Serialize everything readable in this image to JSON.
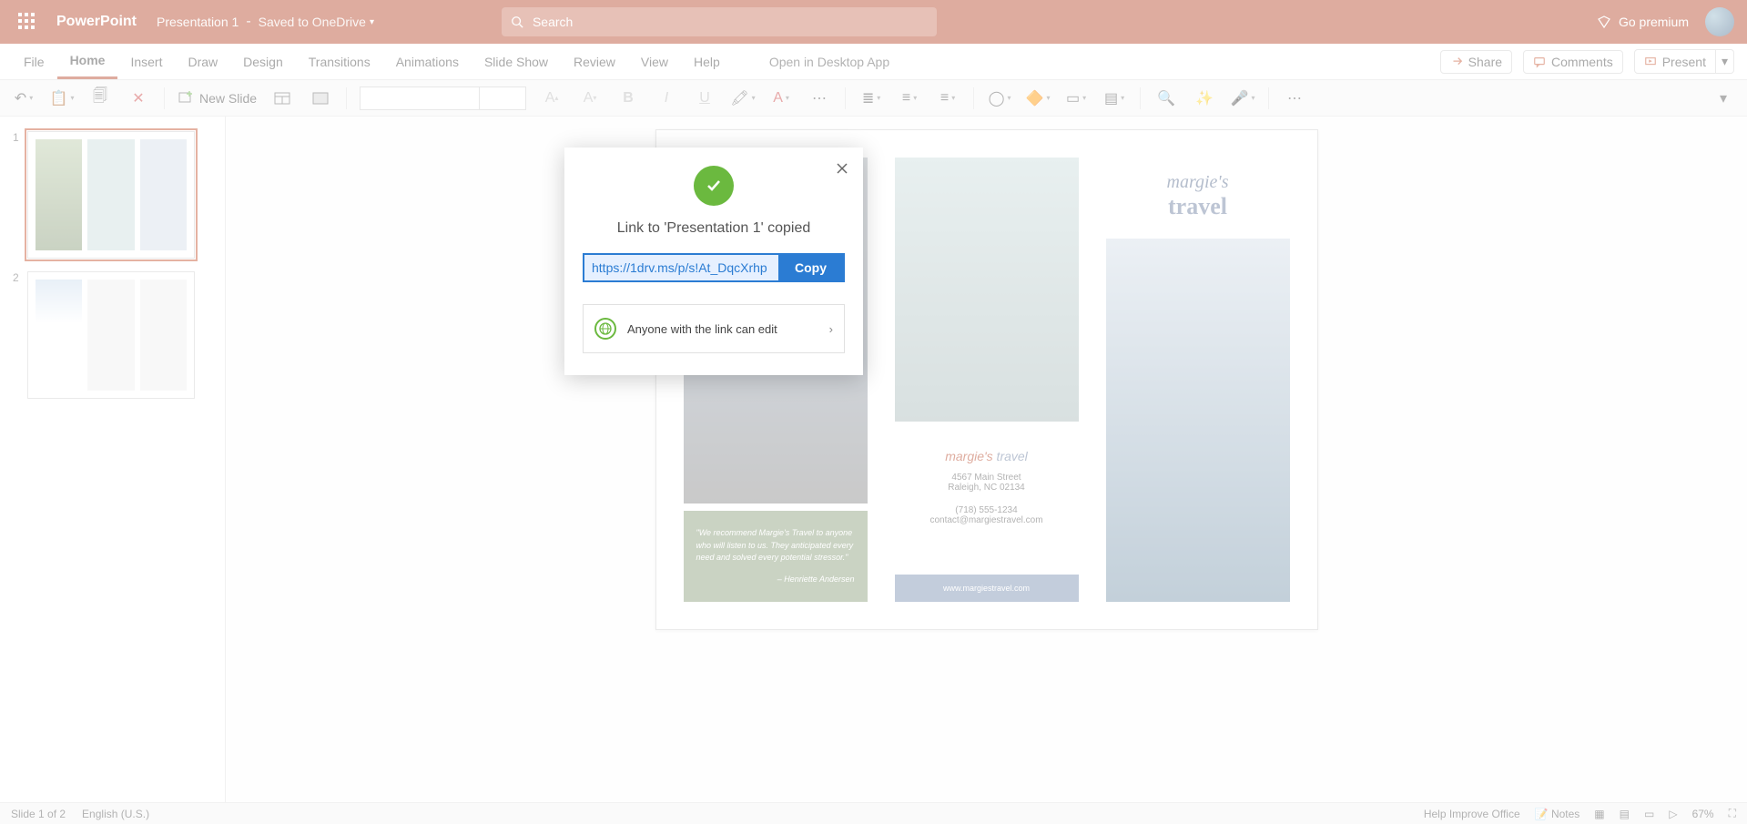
{
  "titlebar": {
    "app": "PowerPoint",
    "doc": "Presentation 1",
    "save_sep": "-",
    "save_loc": "Saved to OneDrive",
    "search_placeholder": "Search",
    "go_premium": "Go premium"
  },
  "tabs": {
    "file": "File",
    "home": "Home",
    "insert": "Insert",
    "draw": "Draw",
    "design": "Design",
    "transitions": "Transitions",
    "animations": "Animations",
    "slideshow": "Slide Show",
    "review": "Review",
    "view": "View",
    "help": "Help",
    "open_desktop": "Open in Desktop App",
    "share": "Share",
    "comments": "Comments",
    "present": "Present"
  },
  "toolbar": {
    "new_slide": "New Slide"
  },
  "thumbs": {
    "n1": "1",
    "n2": "2"
  },
  "slide": {
    "quote": "\"We recommend Margie's Travel to anyone who will listen to us. They anticipated every need and solved every potential stressor.\"",
    "quote_author": "– Henriette Andersen",
    "contact_logo1": "margie's",
    "contact_logo2": " travel",
    "addr1": "4567 Main Street",
    "addr2": "Raleigh, NC 02134",
    "phone": "(718) 555-1234",
    "email": "contact@margiestravel.com",
    "url": "www.margiestravel.com",
    "brand_top": "margie's",
    "brand_bot": "travel"
  },
  "status": {
    "slide": "Slide 1 of 2",
    "lang": "English (U.S.)",
    "help": "Help Improve Office",
    "notes": "Notes",
    "zoom": "67%"
  },
  "modal": {
    "title": "Link to 'Presentation 1' copied",
    "link": "https://1drv.ms/p/s!At_DqcXrhp",
    "copy": "Copy",
    "perm": "Anyone with the link can edit"
  }
}
